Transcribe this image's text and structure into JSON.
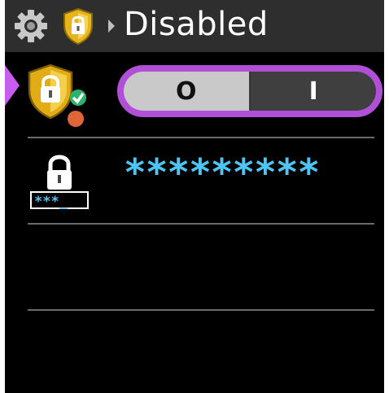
{
  "header": {
    "icons": [
      "gear-icon",
      "shield-lock-icon",
      "breadcrumb-arrow-icon"
    ],
    "title": "Disabled"
  },
  "security_toggle": {
    "off_label": "O",
    "on_label": "I",
    "selected": "off",
    "focus_color": "#b14fd8"
  },
  "password_row": {
    "icon": "password-lock-icon",
    "icon_field_text": "***_",
    "value": "*********",
    "value_color": "#4ec4f2"
  }
}
